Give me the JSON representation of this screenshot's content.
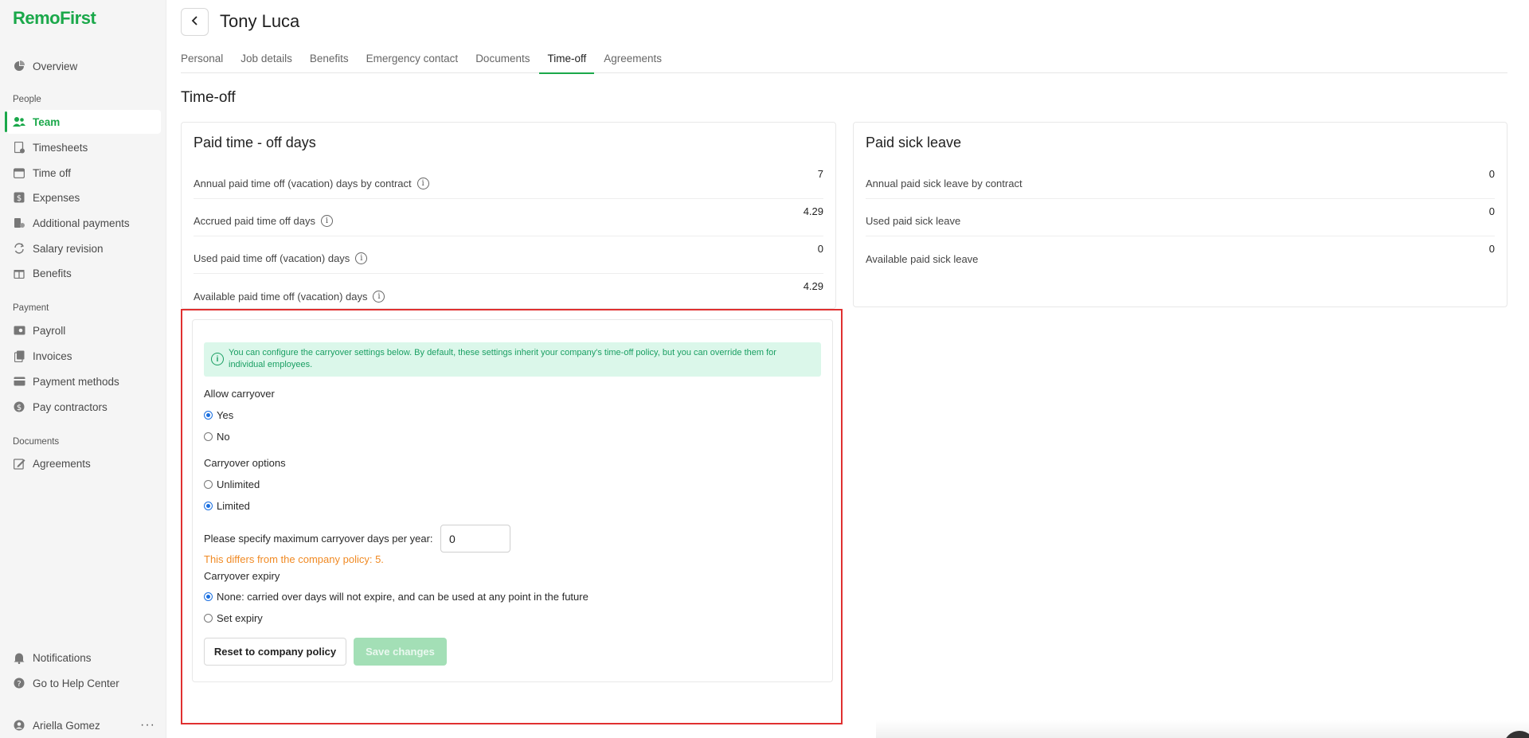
{
  "brand": {
    "logo": "RemoFirst",
    "accent": "#1aa84a"
  },
  "sidebar": {
    "overview": "Overview",
    "section_people": "People",
    "people_items": [
      "Team",
      "Timesheets",
      "Time off",
      "Expenses",
      "Additional payments",
      "Salary revision",
      "Benefits"
    ],
    "section_payment": "Payment",
    "payment_items": [
      "Payroll",
      "Invoices",
      "Payment methods",
      "Pay contractors"
    ],
    "section_documents": "Documents",
    "documents_items": [
      "Agreements"
    ],
    "footer_items": [
      "Notifications",
      "Go to Help Center"
    ],
    "user_name": "Ariella Gomez",
    "user_more": "···"
  },
  "header": {
    "title": "Tony Luca"
  },
  "tabs": [
    "Personal",
    "Job details",
    "Benefits",
    "Emergency contact",
    "Documents",
    "Time-off",
    "Agreements"
  ],
  "active_tab": "Time-off",
  "section_title": "Time-off",
  "pto_card": {
    "title": "Paid time - off days",
    "rows": [
      {
        "label": "Annual paid time off (vacation) days by contract",
        "value": "7"
      },
      {
        "label": "Accrued paid time off days",
        "value": "4.29"
      },
      {
        "label": "Used paid time off (vacation) days",
        "value": "0"
      },
      {
        "label": "Available paid time off (vacation) days",
        "value": "4.29"
      }
    ]
  },
  "sick_card": {
    "title": "Paid sick leave",
    "rows": [
      {
        "label": "Annual paid sick leave by contract",
        "value": "0"
      },
      {
        "label": "Used paid sick leave",
        "value": "0"
      },
      {
        "label": "Available paid sick leave",
        "value": "0"
      }
    ]
  },
  "carryover": {
    "banner": "You can configure the carryover settings below. By default, these settings inherit your company's time-off policy, but you can override them for individual employees.",
    "allow_label": "Allow carryover",
    "allow_yes": "Yes",
    "allow_no": "No",
    "options_label": "Carryover options",
    "opt_unlimited": "Unlimited",
    "opt_limited": "Limited",
    "max_label": "Please specify maximum carryover days per year:",
    "max_value": "0",
    "policy_warning": "This differs from the company policy: 5.",
    "expiry_label": "Carryover expiry",
    "expiry_none": "None: carried over days will not expire, and can be used at any point in the future",
    "expiry_set": "Set expiry",
    "reset_button": "Reset to company policy",
    "save_button": "Save changes"
  }
}
